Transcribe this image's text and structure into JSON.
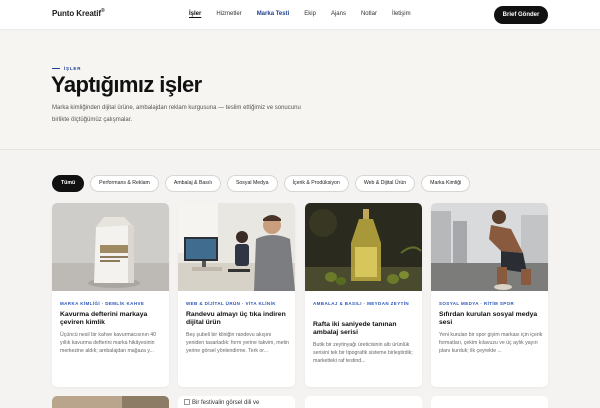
{
  "nav": {
    "brand": "Punto Kreatif",
    "brand_mark": "®",
    "items": [
      {
        "label": "İşler"
      },
      {
        "label": "Hizmetler"
      },
      {
        "label": "Marka Testi"
      },
      {
        "label": "Ekip"
      },
      {
        "label": "Ajans"
      },
      {
        "label": "Notlar"
      },
      {
        "label": "İletişim"
      }
    ],
    "cta": "Brief Gönder"
  },
  "hero": {
    "eyebrow": "İŞLER",
    "title": "Yaptığımız işler",
    "description": "Marka kimliğinden dijital ürüne, ambalajdan reklam kurgusuna — teslim ettiğimiz ve sonucunu birlikte ölçtüğümüz çalışmalar."
  },
  "filters": [
    {
      "label": "Tümü"
    },
    {
      "label": "Performans & Reklam"
    },
    {
      "label": "Ambalaj & Basılı"
    },
    {
      "label": "Sosyal Medya"
    },
    {
      "label": "İçerik & Prodüksiyon"
    },
    {
      "label": "Web & Dijital Ürün"
    },
    {
      "label": "Marka Kimliği"
    }
  ],
  "cards": [
    {
      "category": "MARKA KİMLİĞİ · DEMLİK KAHVE",
      "title": "Kavurma defterini markaya çeviren kimlik",
      "description": "Üçüncü nesil bir kahve kavurmacısının 40 yıllık kavurma defterini marka hikâyesinin merkezine aldık; ambalajdan mağaza y..."
    },
    {
      "category": "WEB & DİJİTAL ÜRÜN · VİTA KLİNİK",
      "title": "Randevu almayı üç tıka indiren dijital ürün",
      "description": "Beş şubeli bir kliniğin randevu akışını yeniden tasarladık: form yerine takvim, metin yerine görsel yönlendirme. Terk or..."
    },
    {
      "category": "AMBALAJ & BASILI · MEYDAN ZEYTİN",
      "title": "Rafta iki saniyede tanınan ambalaj serisi",
      "description": "Butik bir zeytinyağı üreticisinin altı ürünlük serisini tek bir tipografik sisteme birleştirdik; marketteki raf testind..."
    },
    {
      "category": "SOSYAL MEDYA · RİTİM SPOR",
      "title": "Sıfırdan kurulan sosyal medya sesi",
      "description": "Yeni kurulan bir spor giyim markası için içerik formatları, çekim kılavuzu ve üç aylık yayın planı kurduk; ilk çeyrekte ..."
    }
  ],
  "row2": {
    "alt_text": "Bir festivalin görsel dili ve"
  }
}
